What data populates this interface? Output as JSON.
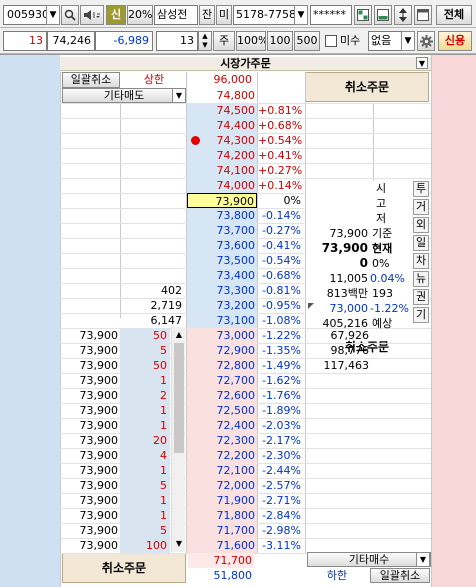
{
  "toolbar1": {
    "code": "005930",
    "credit_label": "신",
    "margin": "20%",
    "stock_name": "삼성전",
    "balance_label": "잔",
    "unfilled_label": "미",
    "account": "5178-7758",
    "password": "******",
    "all_label": "전체"
  },
  "toolbar2": {
    "qty_left": "13",
    "price": "74,246",
    "change": "-6,989",
    "qty": "13",
    "qty_unit": "주",
    "pct_100": "100%",
    "b100": "100",
    "b500": "500",
    "unfilled_check": "미수",
    "none_select": "없음",
    "credit_btn": "신용"
  },
  "grid": {
    "header_market": "시장가주문",
    "batch_cancel": "일괄취소",
    "upper_limit": "상한",
    "other_sell": "기타매도",
    "cancel_order_top": "취소주문",
    "cancel_order_bottom": "취소주문",
    "cancel_order_right": "취소주문",
    "other_buy": "기타매수",
    "lower_limit": "하한",
    "batch_cancel_bottom": "일괄취소",
    "upper_price": "96,000",
    "lower_price": "51,800",
    "lower_first": "71,700"
  },
  "ask_rows": [
    {
      "price": "74,800",
      "pct": "",
      "qty": ""
    },
    {
      "price": "74,500",
      "pct": "+0.81%",
      "qty": ""
    },
    {
      "price": "74,400",
      "pct": "+0.68%",
      "qty": ""
    },
    {
      "price": "74,300",
      "pct": "+0.54%",
      "qty": "",
      "dot": true
    },
    {
      "price": "74,200",
      "pct": "+0.41%",
      "qty": ""
    },
    {
      "price": "74,100",
      "pct": "+0.27%",
      "qty": ""
    },
    {
      "price": "74,000",
      "pct": "+0.14%",
      "qty": ""
    },
    {
      "price": "73,900",
      "pct": "0%",
      "qty": "",
      "current": true
    },
    {
      "price": "73,800",
      "pct": "-0.14%",
      "qty": ""
    },
    {
      "price": "73,700",
      "pct": "-0.27%",
      "qty": ""
    },
    {
      "price": "73,600",
      "pct": "-0.41%",
      "qty": ""
    },
    {
      "price": "73,500",
      "pct": "-0.54%",
      "qty": ""
    },
    {
      "price": "73,400",
      "pct": "-0.68%",
      "qty": ""
    },
    {
      "price": "73,300",
      "pct": "-0.81%",
      "qty": "402"
    },
    {
      "price": "73,200",
      "pct": "-0.95%",
      "qty": "2,719"
    },
    {
      "price": "73,100",
      "pct": "-1.08%",
      "qty": "6,147"
    }
  ],
  "bid_rows": [
    {
      "p1": "73,900",
      "q": "50",
      "price": "73,000",
      "pct": "-1.22%",
      "bq": "67,926"
    },
    {
      "p1": "73,900",
      "q": "5",
      "price": "72,900",
      "pct": "-1.35%",
      "bq": "98,776"
    },
    {
      "p1": "73,900",
      "q": "50",
      "price": "72,800",
      "pct": "-1.49%",
      "bq": "117,463"
    },
    {
      "p1": "73,900",
      "q": "1",
      "price": "72,700",
      "pct": "-1.62%",
      "bq": ""
    },
    {
      "p1": "73,900",
      "q": "2",
      "price": "72,600",
      "pct": "-1.76%",
      "bq": ""
    },
    {
      "p1": "73,900",
      "q": "1",
      "price": "72,500",
      "pct": "-1.89%",
      "bq": ""
    },
    {
      "p1": "73,900",
      "q": "1",
      "price": "72,400",
      "pct": "-2.03%",
      "bq": ""
    },
    {
      "p1": "73,900",
      "q": "20",
      "price": "72,300",
      "pct": "-2.17%",
      "bq": ""
    },
    {
      "p1": "73,900",
      "q": "4",
      "price": "72,200",
      "pct": "-2.30%",
      "bq": ""
    },
    {
      "p1": "73,900",
      "q": "1",
      "price": "72,100",
      "pct": "-2.44%",
      "bq": ""
    },
    {
      "p1": "73,900",
      "q": "5",
      "price": "72,000",
      "pct": "-2.57%",
      "bq": ""
    },
    {
      "p1": "73,900",
      "q": "1",
      "price": "71,900",
      "pct": "-2.71%",
      "bq": ""
    },
    {
      "p1": "73,900",
      "q": "1",
      "price": "71,800",
      "pct": "-2.84%",
      "bq": ""
    },
    {
      "p1": "73,900",
      "q": "5",
      "price": "71,700",
      "pct": "-2.98%",
      "bq": ""
    },
    {
      "p1": "73,900",
      "q": "100",
      "price": "71,600",
      "pct": "-3.11%",
      "bq": ""
    }
  ],
  "info": {
    "lbl_open": "시",
    "lbl_high": "고",
    "lbl_low": "저",
    "base_val": "73,900",
    "base_lbl": "기준",
    "cur_val": "73,900",
    "cur_lbl": "현재",
    "chg_val": "0",
    "chg_pct": "0%",
    "vol": "11,005",
    "vol_pct": "0.04%",
    "amount": "813백만",
    "amount_n": "193",
    "exp_price": "73,000",
    "exp_pct": "-1.22%",
    "exp_qty": "405,216",
    "exp_lbl": "예상"
  },
  "side_tabs": [
    "투",
    "거",
    "외",
    "일",
    "차",
    "뉴",
    "권",
    "기"
  ]
}
